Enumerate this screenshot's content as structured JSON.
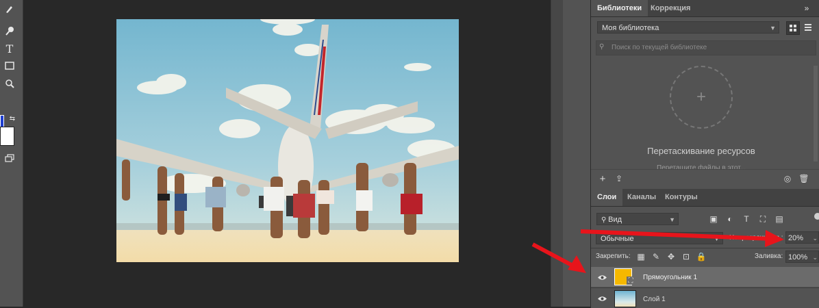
{
  "libraries_panel": {
    "tabs": [
      "Библиотеки",
      "Коррекция"
    ],
    "library_select": "Моя библиотека",
    "search_placeholder": "Поиск по текущей библиотеке",
    "drop_title": "Перетаскивание ресурсов",
    "drop_subtitle": "Перетащите файлы в этот...",
    "add_symbol": "+"
  },
  "layers_panel": {
    "tabs": [
      "Слои",
      "Каналы",
      "Контуры"
    ],
    "filter_label": "Вид",
    "blend_mode": "Обычные",
    "opacity_label": "Непрозрачность:",
    "opacity_value": "20%",
    "lock_label": "Закрепить:",
    "fill_label": "Заливка:",
    "fill_value": "100%",
    "layers": [
      {
        "name": "Прямоугольник 1",
        "selected": true,
        "thumb_color": "#f5b800"
      },
      {
        "name": "Слой 1",
        "selected": false
      }
    ]
  },
  "colors": {
    "foreground": "#1f3fd0",
    "background": "#ffffff",
    "annotation_arrow": "#e8141b",
    "rect_layer_fill": "#f5b800"
  },
  "icons": [
    "brush-icon",
    "eyedropper-icon",
    "text-tool-icon",
    "rectangle-tool-icon",
    "zoom-icon",
    "swap-colors-icon",
    "screen-mode-icon"
  ]
}
